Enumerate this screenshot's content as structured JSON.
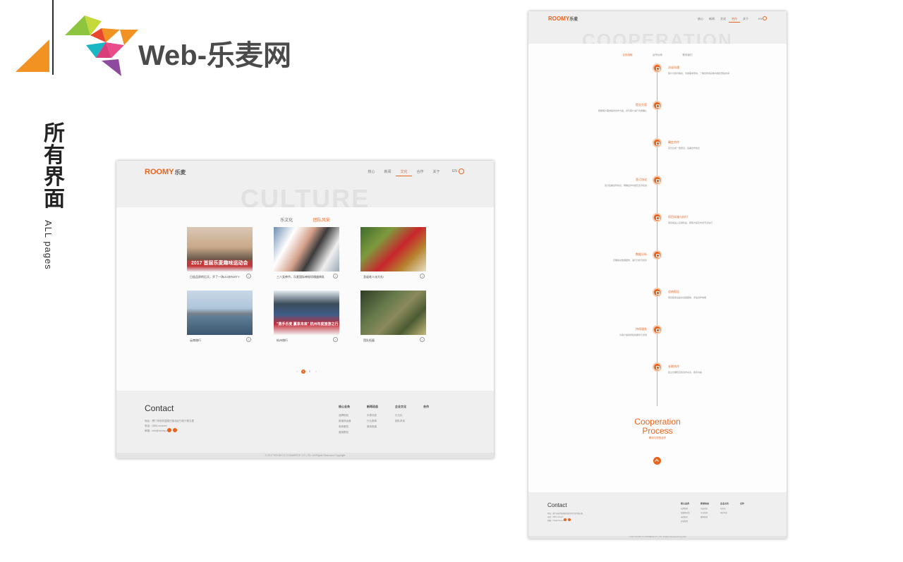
{
  "branding": {
    "title": "Web-乐麦网",
    "side_title": "所有界面",
    "side_subtitle": "ALL pages",
    "colors": {
      "orange": "#f29222",
      "green": "#8cc63f",
      "pink": "#e84c8b",
      "teal": "#19b6c4",
      "purple": "#8e4a9c",
      "red": "#e8462e"
    }
  },
  "culture_page": {
    "logo": "ROOMY",
    "logo_cn": "乐麦",
    "nav": [
      "核心",
      "新闻",
      "文化",
      "合作",
      "关于"
    ],
    "nav_active_index": 2,
    "lang": "EN",
    "banner_text": "CULTURE",
    "tabs": [
      "乐文化",
      "团队风采"
    ],
    "tab_active_index": 1,
    "cards": [
      {
        "caption": "日益品质的后天，开了一场UU派PARTY",
        "overlay": "2017 首届乐麦趣味运动会"
      },
      {
        "caption": "三八女神节，乐麦国际神秘玫瑰盛典乳"
      },
      {
        "caption": "圣诞老人派大礼!"
      },
      {
        "caption": "云南旅行"
      },
      {
        "caption": "杭州旅行",
        "overlay": "\"携手乐麦 赢享未来\" 杭州年度旅游之行"
      },
      {
        "caption": "团队拓展"
      }
    ],
    "pager": [
      "‹",
      "1",
      "2",
      "›"
    ],
    "pager_active_index": 1,
    "footer": {
      "contact": "Contact",
      "address_lines": [
        "地址：厦门市软件园观日路北区行政厅楼五楼",
        "电话：0592-xxxxxxx",
        "邮箱：info@roomy.cn"
      ],
      "columns": [
        {
          "title": "核心业务",
          "items": [
            "品牌规划",
            "新媒体运营",
            "电商服务",
            "营销策划"
          ]
        },
        {
          "title": "新闻动态",
          "items": [
            "乐麦动态",
            "行业新闻",
            "媒体报道"
          ]
        },
        {
          "title": "企业文化",
          "items": [
            "乐文化",
            "团队风采"
          ]
        },
        {
          "title": "合作",
          "items": []
        }
      ],
      "copyright": "© 2017 ROOMY E-COMMERCE CO.,LTD. All Rights Reserved Copyright"
    }
  },
  "cooperation_page": {
    "logo": "ROOMY",
    "logo_cn": "乐麦",
    "nav": [
      "核心",
      "新闻",
      "文化",
      "合作",
      "关于"
    ],
    "nav_active_index": 3,
    "lang": "EN",
    "banner_text": "COOPERATION",
    "tabs": [
      "合作流程",
      "合作伙伴",
      "联系我们"
    ],
    "tab_active_index": 0,
    "steps": [
      {
        "title": "洽谈沟通",
        "desc": "客户与我们联系，沟通需求意向，了解合作的具体内容及预估时间",
        "side": "right"
      },
      {
        "title": "提交方案",
        "desc": "根据客户需求提供合作方案，并与客户进行沟通确认",
        "side": "left"
      },
      {
        "title": "确定合作",
        "desc": "双方达成一致意见，签署合作协议",
        "side": "right"
      },
      {
        "title": "签订协议",
        "desc": "双方签署合作协议，明确合作内容及双方权责",
        "side": "left"
      },
      {
        "title": "项目实施与执行",
        "desc": "项目组进入实施阶段，按照方案及时间节点执行",
        "side": "right"
      },
      {
        "title": "数据分析",
        "desc": "定期提交数据报告，进行分析与优化",
        "side": "left"
      },
      {
        "title": "总结报告",
        "desc": "项目结束后提交总结报告，评估合作效果",
        "side": "right"
      },
      {
        "title": "持续服务",
        "desc": "为客户提供持续的服务与支持",
        "side": "left"
      },
      {
        "title": "长期合作",
        "desc": "建立长期稳定的合作关系，携手共赢",
        "side": "right"
      }
    ],
    "process_title_1": "Cooperation",
    "process_title_2": "Process",
    "process_sub": "期待与您的合作",
    "footer": {
      "contact": "Contact",
      "address_lines": [
        "地址：厦门市软件园观日路北区行政厅楼五楼",
        "电话：0592-xxxxxxx",
        "邮箱：info@roomy.cn"
      ],
      "columns": [
        {
          "title": "核心业务",
          "items": [
            "品牌规划",
            "新媒体运营",
            "电商服务",
            "营销策划"
          ]
        },
        {
          "title": "新闻动态",
          "items": [
            "乐麦动态",
            "行业新闻",
            "媒体报道"
          ]
        },
        {
          "title": "企业文化",
          "items": [
            "乐文化",
            "团队风采"
          ]
        },
        {
          "title": "合作",
          "items": []
        }
      ],
      "copyright": "© 2017 ROOMY E-COMMERCE CO.,LTD. All Rights Reserved Copyright"
    }
  }
}
